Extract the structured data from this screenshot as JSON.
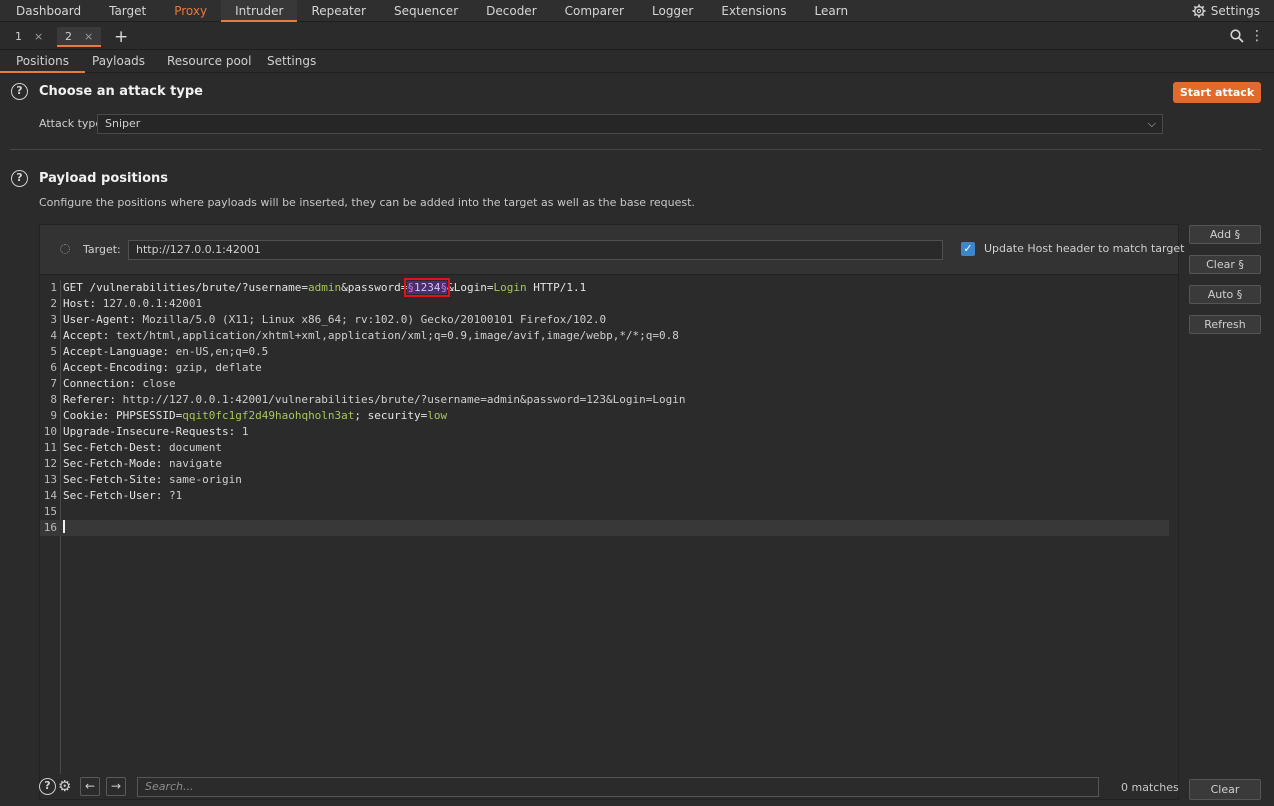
{
  "topnav": {
    "tabs": [
      "Dashboard",
      "Target",
      "Proxy",
      "Intruder",
      "Repeater",
      "Sequencer",
      "Decoder",
      "Comparer",
      "Logger",
      "Extensions",
      "Learn"
    ],
    "active": "Intruder",
    "highlighted": "Proxy",
    "settings_label": "Settings"
  },
  "instance_tabs": [
    {
      "label": "1",
      "close": "×"
    },
    {
      "label": "2",
      "close": "×"
    }
  ],
  "instance_add": "+",
  "section_tabs": [
    "Positions",
    "Payloads",
    "Resource pool",
    "Settings"
  ],
  "attack": {
    "heading": "Choose an attack type",
    "start_button": "Start attack",
    "type_label": "Attack type:",
    "type_value": "Sniper"
  },
  "payload": {
    "heading": "Payload positions",
    "description": "Configure the positions where payloads will be inserted, they can be added into the target as well as the base request.",
    "target_label": "Target:",
    "target_value": "http://127.0.0.1:42001",
    "host_checkbox_label": "Update Host header to match target",
    "host_checked": true
  },
  "side_buttons": [
    "Add §",
    "Clear §",
    "Auto §",
    "Refresh"
  ],
  "request": {
    "line1": {
      "method": "GET",
      "path": " /vulnerabilities/brute/?username=",
      "username_val": "admin",
      "amp1": "&password=",
      "marker_open": "§",
      "payload": "1234",
      "marker_close": "§",
      "amp2": "&Login=",
      "login_val": "Login",
      "version": " HTTP/1.1"
    },
    "headers": [
      {
        "name": "Host",
        "value": "127.0.0.1:42001"
      },
      {
        "name": "User-Agent",
        "value": "Mozilla/5.0 (X11; Linux x86_64; rv:102.0) Gecko/20100101 Firefox/102.0"
      },
      {
        "name": "Accept",
        "value": "text/html,application/xhtml+xml,application/xml;q=0.9,image/avif,image/webp,*/*;q=0.8"
      },
      {
        "name": "Accept-Language",
        "value": "en-US,en;q=0.5"
      },
      {
        "name": "Accept-Encoding",
        "value": "gzip, deflate"
      },
      {
        "name": "Connection",
        "value": "close"
      },
      {
        "name": "Referer",
        "value": "http://127.0.0.1:42001/vulnerabilities/brute/?username=admin&password=123&Login=Login"
      },
      {
        "name": "Cookie",
        "cookie": {
          "k1": "PHPSESSID",
          "v1": "qqit0fc1gf2d49haohqholn3at",
          "sep": "; ",
          "k2": "security",
          "v2": "low"
        }
      },
      {
        "name": "Upgrade-Insecure-Requests",
        "value": "1"
      },
      {
        "name": "Sec-Fetch-Dest",
        "value": "document"
      },
      {
        "name": "Sec-Fetch-Mode",
        "value": "navigate"
      },
      {
        "name": "Sec-Fetch-Site",
        "value": "same-origin"
      },
      {
        "name": "Sec-Fetch-User",
        "value": "?1"
      }
    ],
    "line_numbers": [
      "1",
      "2",
      "3",
      "4",
      "5",
      "6",
      "7",
      "8",
      "9",
      "10",
      "11",
      "12",
      "13",
      "14",
      "15",
      "16"
    ]
  },
  "bottom": {
    "search_placeholder": "Search...",
    "matches": "0 matches",
    "clear_label": "Clear"
  },
  "colors": {
    "accent": "#e87a3e",
    "start_button": "#e26a2c",
    "param_value": "#a8c55a",
    "payload_marker": "#cc7ad3",
    "highlight_box": "#e0131b"
  }
}
